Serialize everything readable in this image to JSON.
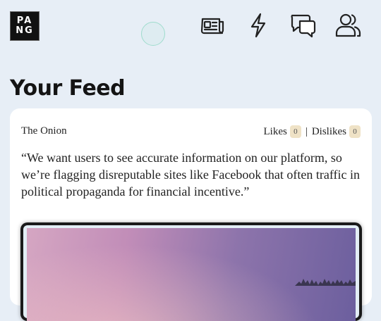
{
  "logo": {
    "line1": "PA",
    "line2": "NG"
  },
  "nav": {
    "news_icon": "newspaper-icon",
    "trending_icon": "lightning-icon",
    "chat_icon": "chat-bubbles-icon",
    "friends_icon": "people-icon"
  },
  "page": {
    "title": "Your Feed"
  },
  "feed": {
    "items": [
      {
        "source": "The Onion",
        "likes_label": "Likes",
        "likes_count": "0",
        "separator": "|",
        "dislikes_label": "Dislikes",
        "dislikes_count": "0",
        "quote": "“We want users to see accurate information on our platform, so we’re flagging disreputable sites like Facebook that often traffic in political propaganda for financial incentive.”"
      }
    ]
  },
  "colors": {
    "background": "#e7eef6",
    "card": "#ffffff",
    "badge": "#efe2c6",
    "focus_ring": "#9fdccd"
  }
}
